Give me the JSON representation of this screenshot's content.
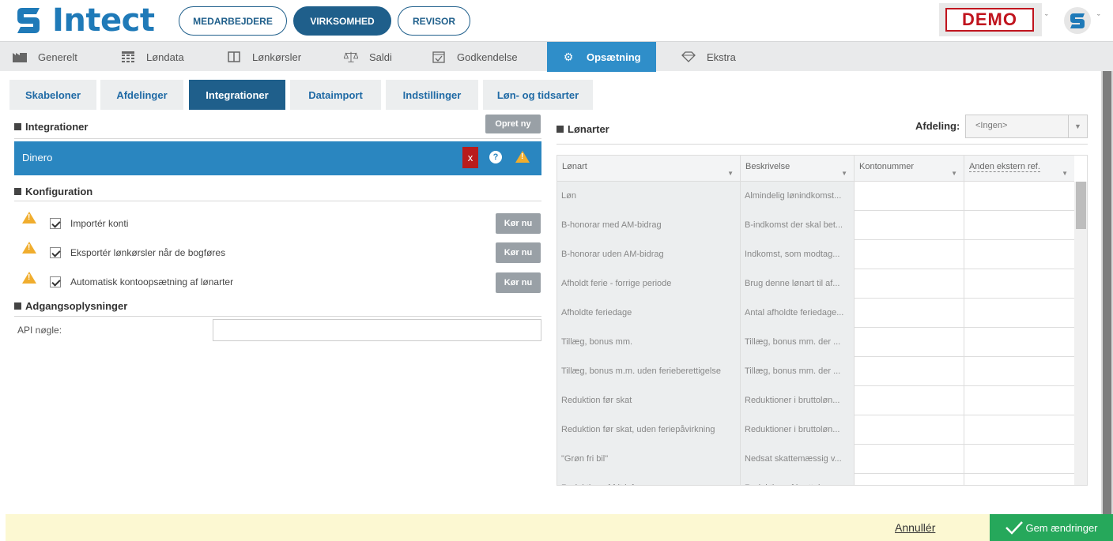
{
  "app": {
    "logo_text": "Intect",
    "roles": [
      "MEDARBEJDERE",
      "VIRKSOMHED",
      "REVISOR"
    ],
    "demo_label": "DEMO"
  },
  "mainnav": [
    {
      "label": "Generelt",
      "icon": "factory-icon"
    },
    {
      "label": "Løndata",
      "icon": "table-icon"
    },
    {
      "label": "Lønkørsler",
      "icon": "book-icon"
    },
    {
      "label": "Saldi",
      "icon": "scale-icon"
    },
    {
      "label": "Godkendelse",
      "icon": "calendar-check-icon"
    },
    {
      "label": "Opsætning",
      "icon": "gear-icon",
      "active": true
    },
    {
      "label": "Ekstra",
      "icon": "diamond-icon"
    }
  ],
  "subtabs": [
    "Skabeloner",
    "Afdelinger",
    "Integrationer",
    "Dataimport",
    "Indstillinger",
    "Løn- og tidsarter"
  ],
  "integrations": {
    "title": "Integrationer",
    "create_label": "Opret ny",
    "items": [
      {
        "name": "Dinero",
        "delete_label": "x",
        "help_label": "?"
      }
    ]
  },
  "configuration": {
    "title": "Konfiguration",
    "run_label": "Kør nu",
    "items": [
      {
        "label": "Importér konti",
        "checked": true
      },
      {
        "label": "Eksportér lønkørsler når de bogføres",
        "checked": true
      },
      {
        "label": "Automatisk kontoopsætning af lønarter",
        "checked": true
      }
    ]
  },
  "access": {
    "title": "Adgangsoplysninger",
    "api_label": "API nøgle:",
    "api_value": ""
  },
  "wagetypes": {
    "title": "Lønarter",
    "department_label": "Afdeling:",
    "department_value": "<Ingen>",
    "columns": [
      "Lønart",
      "Beskrivelse",
      "Kontonummer",
      "Anden ekstern ref."
    ],
    "rows": [
      [
        "Løn",
        "Almindelig lønindkomst...",
        "",
        ""
      ],
      [
        "B-honorar med AM-bidrag",
        "B-indkomst der skal bet...",
        "",
        ""
      ],
      [
        "B-honorar uden AM-bidrag",
        "Indkomst, som modtag...",
        "",
        ""
      ],
      [
        "Afholdt ferie - forrige periode",
        "Brug denne lønart til af...",
        "",
        ""
      ],
      [
        "Afholdte feriedage",
        "Antal afholdte feriedage...",
        "",
        ""
      ],
      [
        "Tillæg, bonus mm.",
        "Tillæg, bonus mm. der ...",
        "",
        ""
      ],
      [
        "Tillæg, bonus m.m. uden ferieberettigelse",
        "Tillæg, bonus mm. der ...",
        "",
        ""
      ],
      [
        "Reduktion før skat",
        "Reduktioner i bruttoløn...",
        "",
        ""
      ],
      [
        "Reduktion før skat, uden feriepåvirkning",
        "Reduktioner i bruttoløn...",
        "",
        ""
      ],
      [
        "\"Grøn fri bil\"",
        "Nedsat skattemæssig v...",
        "",
        ""
      ],
      [
        "Reduktion af frit lof...",
        "Reduktion af bruttoi...",
        "",
        ""
      ]
    ]
  },
  "footer": {
    "cancel_label": "Annullér",
    "save_label": "Gem ændringer"
  },
  "colors": {
    "brand": "#1f7ab8",
    "nav_active": "#2f8ec9",
    "role_active": "#1f5f8b",
    "save": "#26a85b",
    "warning": "#f0ad2e",
    "danger": "#b91c1c"
  }
}
